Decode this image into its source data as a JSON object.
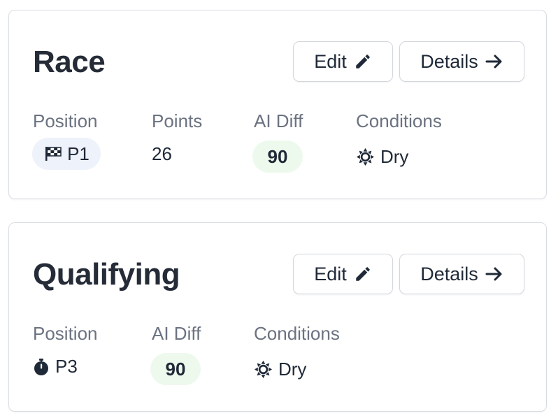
{
  "cards": [
    {
      "title": "Race",
      "edit_label": "Edit",
      "details_label": "Details",
      "stats": {
        "position": {
          "label": "Position",
          "value": "P1",
          "icon": "checkered-flag-icon"
        },
        "points": {
          "label": "Points",
          "value": "26"
        },
        "ai_diff": {
          "label": "AI Diff",
          "value": "90"
        },
        "conditions": {
          "label": "Conditions",
          "value": "Dry",
          "icon": "sun-icon"
        }
      }
    },
    {
      "title": "Qualifying",
      "edit_label": "Edit",
      "details_label": "Details",
      "stats": {
        "position": {
          "label": "Position",
          "value": "P3",
          "icon": "stopwatch-icon"
        },
        "ai_diff": {
          "label": "AI Diff",
          "value": "90"
        },
        "conditions": {
          "label": "Conditions",
          "value": "Dry",
          "icon": "sun-icon"
        }
      }
    }
  ],
  "colors": {
    "position_pill_bg": "#eef2fa",
    "ai_diff_pill_bg": "#eef9ee"
  }
}
